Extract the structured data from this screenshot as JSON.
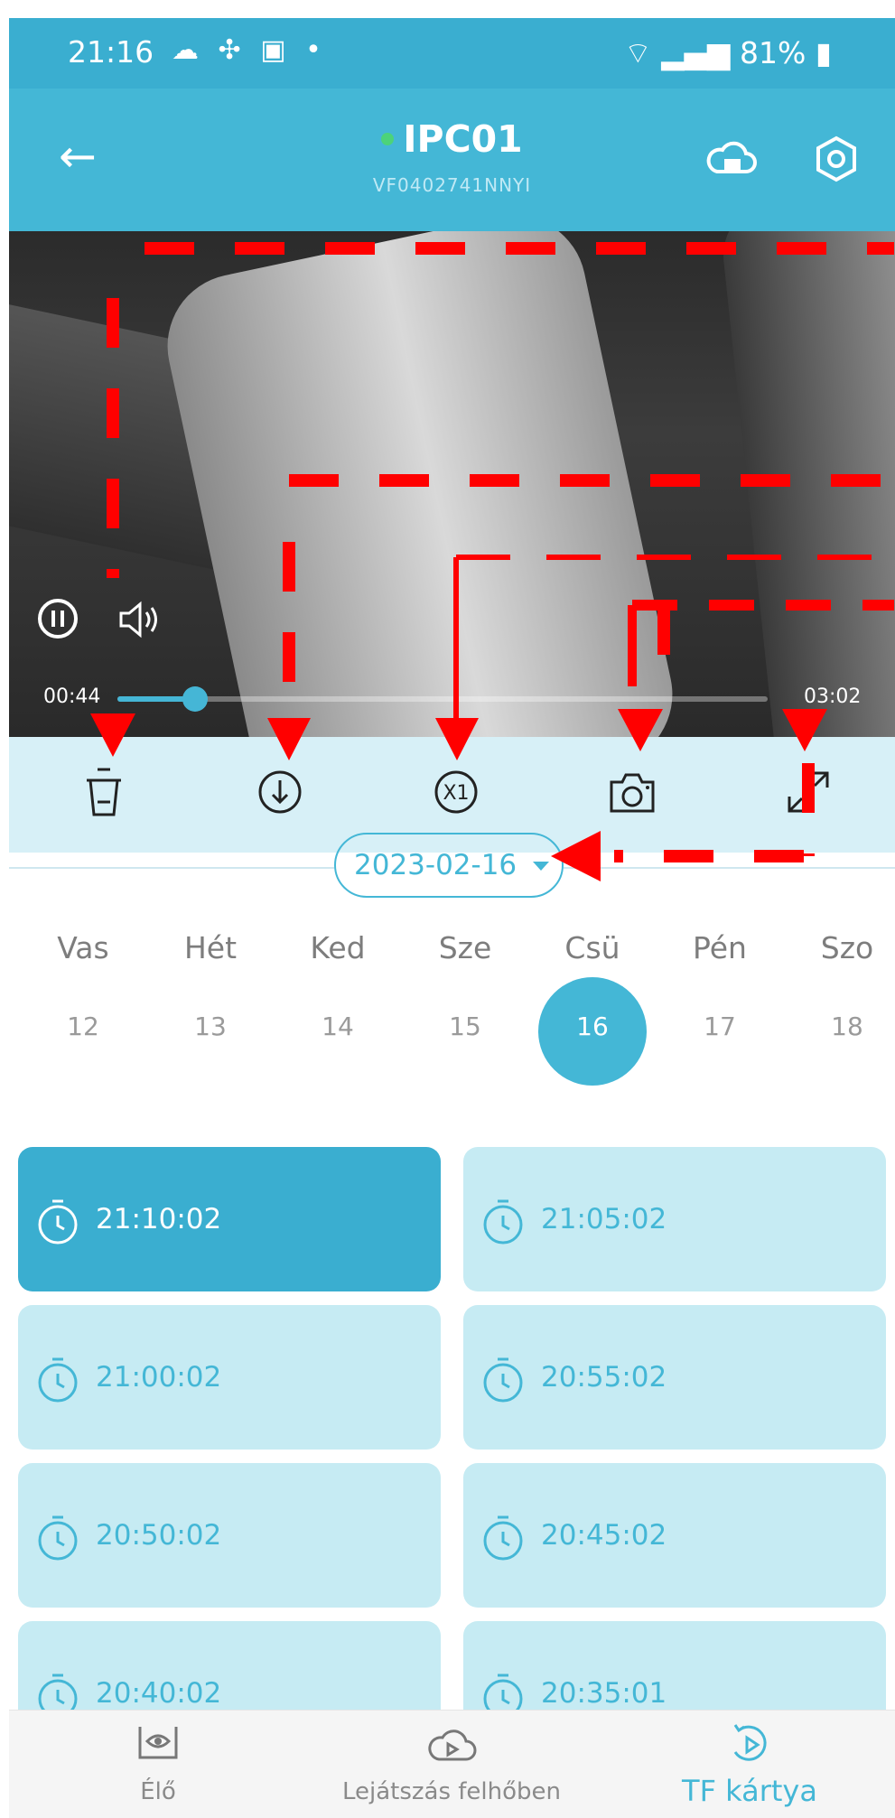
{
  "status_bar": {
    "time": "21:16",
    "left_icons": "☁ ✣ ▣ •",
    "right": "81%"
  },
  "header": {
    "title": "IPC01",
    "subtitle": "VF0402741NNYI"
  },
  "player": {
    "current_time": "00:44",
    "end_time": "03:02",
    "progress": 0.12
  },
  "toolbar": {
    "items": [
      {
        "name": "delete",
        "icon": "trash-icon"
      },
      {
        "name": "download",
        "icon": "download-icon"
      },
      {
        "name": "speed",
        "icon": "speed-x1-icon",
        "label": "X1"
      },
      {
        "name": "snapshot",
        "icon": "camera-icon"
      },
      {
        "name": "fullscreen",
        "icon": "expand-icon"
      }
    ]
  },
  "date": {
    "selected": "2023-02-16"
  },
  "week": {
    "days": [
      {
        "name": "Vas",
        "num": "12"
      },
      {
        "name": "Hét",
        "num": "13"
      },
      {
        "name": "Ked",
        "num": "14"
      },
      {
        "name": "Sze",
        "num": "15"
      },
      {
        "name": "Csü",
        "num": "16"
      },
      {
        "name": "Pén",
        "num": "17"
      },
      {
        "name": "Szo",
        "num": "18"
      }
    ],
    "selected_index": 4
  },
  "clips": [
    {
      "time": "21:10:02"
    },
    {
      "time": "21:05:02"
    },
    {
      "time": "21:00:02"
    },
    {
      "time": "20:55:02"
    },
    {
      "time": "20:50:02"
    },
    {
      "time": "20:45:02"
    },
    {
      "time": "20:40:02"
    },
    {
      "time": "20:35:01"
    }
  ],
  "bottom_nav": {
    "items": [
      {
        "label": "Élő",
        "icon": "live-eye-icon"
      },
      {
        "label": "Lejátszás felhőben",
        "icon": "cloud-playback-icon"
      },
      {
        "label": "TF kártya",
        "icon": "tf-card-playback-icon"
      }
    ],
    "active_index": 2
  },
  "colors": {
    "accent": "#44b7d6",
    "annotation": "#ff0000",
    "toolbar_bg": "#d7f0f7",
    "clip_bg": "#c6ebf3"
  }
}
